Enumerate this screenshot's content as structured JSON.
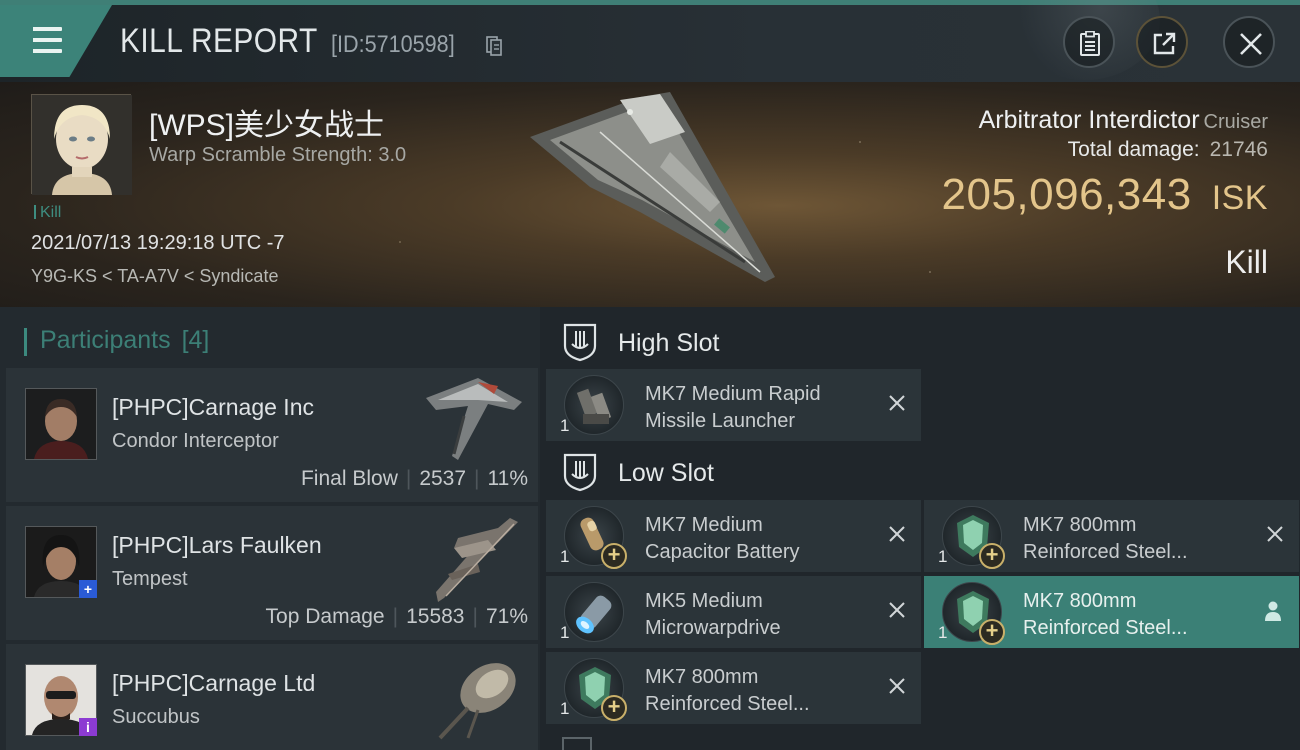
{
  "header": {
    "title": "KILL REPORT",
    "id_label": "[ID:5710598]"
  },
  "victim": {
    "name": "[WPS]美少女战士",
    "subtitle": "Warp Scramble Strength: 3.0",
    "tag": "Kill",
    "timestamp": "2021/07/13 19:29:18 UTC -7",
    "location": "Y9G-KS < TA-A7V < Syndicate",
    "ship_name": "Arbitrator Interdictor",
    "ship_class": "Cruiser",
    "total_damage_label": "Total damage:",
    "total_damage_value": "21746",
    "isk_value": "205,096,343",
    "isk_unit": "ISK",
    "result": "Kill"
  },
  "participants": {
    "label": "Participants",
    "count": "[4]",
    "rows": [
      {
        "name": "[PHPC]Carnage Inc",
        "ship": "Condor Interceptor",
        "role": "Final Blow",
        "damage": "2537",
        "percent": "11%",
        "badge": ""
      },
      {
        "name": "[PHPC]Lars Faulken",
        "ship": "Tempest",
        "role": "Top Damage",
        "damage": "15583",
        "percent": "71%",
        "badge": "+"
      },
      {
        "name": "[PHPC]Carnage Ltd",
        "ship": "Succubus",
        "role": "",
        "damage": "",
        "percent": "",
        "badge": "i"
      }
    ]
  },
  "fitting": {
    "high_slot_label": "High Slot",
    "low_slot_label": "Low Slot",
    "high": [
      {
        "qty": "1",
        "name_line1": "MK7 Medium Rapid",
        "name_line2": "Missile Launcher"
      }
    ],
    "low": [
      {
        "qty": "1",
        "name_line1": "MK7 Medium",
        "name_line2": "Capacitor Battery"
      },
      {
        "qty": "1",
        "name_line1": "MK7 800mm",
        "name_line2": "Reinforced Steel..."
      },
      {
        "qty": "1",
        "name_line1": "MK5 Medium",
        "name_line2": "Microwarpdrive"
      },
      {
        "qty": "1",
        "name_line1": "MK7 800mm",
        "name_line2": "Reinforced Steel..."
      },
      {
        "qty": "1",
        "name_line1": "MK7 800mm",
        "name_line2": "Reinforced Steel..."
      }
    ]
  },
  "colors": {
    "accent_teal": "#3c8379",
    "isk_gold": "#e3c58b",
    "selected_row": "#3b8076",
    "panel": "#2b3338"
  }
}
